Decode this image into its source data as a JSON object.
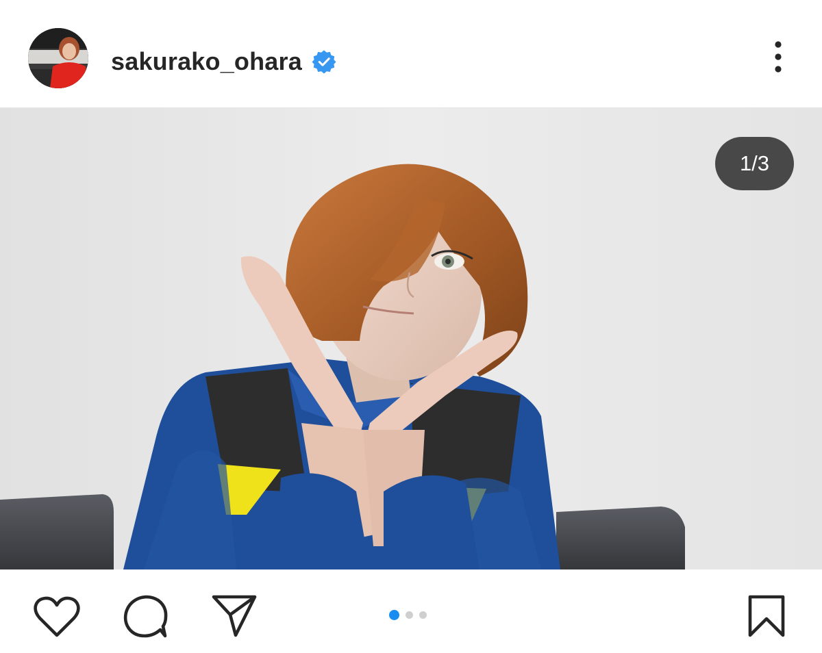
{
  "post": {
    "username": "sakurako_ohara",
    "verified": true,
    "counter": "1/3",
    "carousel": {
      "current": 1,
      "total": 3
    },
    "colors": {
      "verified_badge": "#3897f0",
      "active_dot": "#1a8ef0",
      "inactive_dot": "#cfcfcf",
      "icon_stroke": "#262626"
    }
  },
  "header": {
    "avatar_icon": "profile-photo",
    "more_icon": "more-vertical-icon"
  },
  "actions": {
    "like_icon": "heart-icon",
    "comment_icon": "comment-bubble-icon",
    "share_icon": "paper-plane-icon",
    "save_icon": "bookmark-icon"
  }
}
